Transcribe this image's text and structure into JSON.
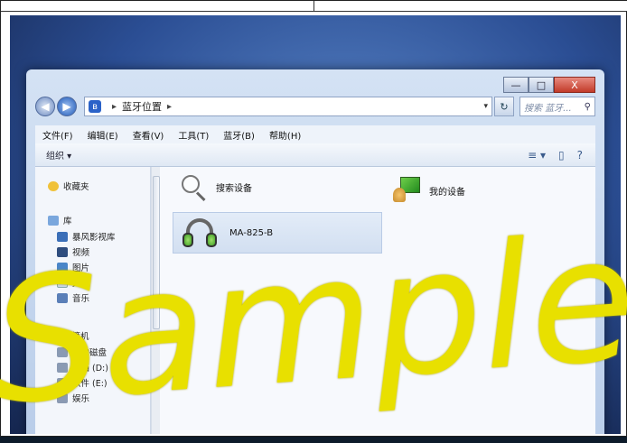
{
  "window": {
    "controls": {
      "minimize": "—",
      "maximize": "□",
      "close": "X"
    },
    "address": {
      "back_icon": "back-arrow-icon",
      "forward_icon": "forward-arrow-icon",
      "crumb_root_icon": "bluetooth-icon",
      "crumb_separator": "▸",
      "crumb": "蓝牙位置",
      "crumb_tail": "▸",
      "dropdown": "▾",
      "refresh": "↻",
      "search_placeholder": "搜索 蓝牙...",
      "search_icon": "⚲"
    },
    "menu": [
      "文件(F)",
      "编辑(E)",
      "查看(V)",
      "工具(T)",
      "蓝牙(B)",
      "帮助(H)"
    ],
    "toolbar": {
      "organize": "组织 ▾",
      "view_icon": "≡ ▾",
      "pane_icon": "▯",
      "help_icon": "?"
    },
    "nav": {
      "favorites": "收藏夹",
      "library": "库",
      "items": [
        "暴风影视库",
        "视频",
        "图片",
        "文档",
        "音乐"
      ],
      "computer": "计算机",
      "drives": [
        "本地磁盘",
        "文档 (D:)",
        "软件 (E:)",
        "娱乐"
      ]
    },
    "content": {
      "search_devices": "搜索设备",
      "my_devices": "我的设备",
      "device_name": "MA-825-B"
    }
  },
  "watermark": {
    "text": "Sample",
    "color": "#e8e000"
  }
}
